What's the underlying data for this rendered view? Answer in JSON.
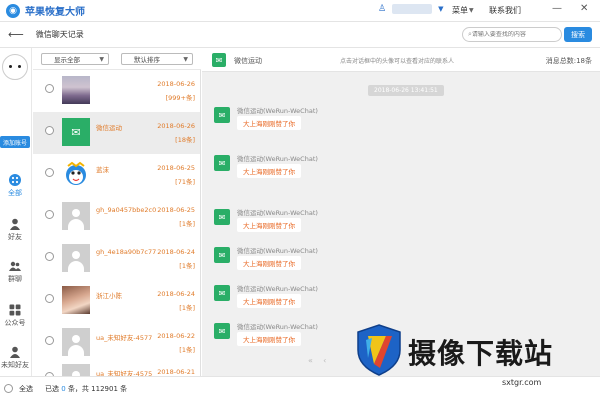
{
  "app": {
    "title": "苹果恢复大师",
    "menu_label": "菜单",
    "contact_label": "联系我们",
    "user_icon": "user-icon"
  },
  "subbar": {
    "title": "微信聊天记录",
    "search_placeholder": "请输入要查找的内容",
    "search_button": "搜索"
  },
  "leftnav": {
    "add_account": "添加账号",
    "items": [
      {
        "label": "全部",
        "icon": "grid-dots-icon",
        "active": true
      },
      {
        "label": "好友",
        "icon": "person-icon",
        "active": false
      },
      {
        "label": "群聊",
        "icon": "group-icon",
        "active": false
      },
      {
        "label": "公众号",
        "icon": "apps-icon",
        "active": false
      },
      {
        "label": "未知好友",
        "icon": "unknown-person-icon",
        "active": false
      }
    ]
  },
  "filters": {
    "show": "显示全部",
    "sort": "默认排序"
  },
  "contacts": [
    {
      "name": "",
      "date": "2018-06-26",
      "count": "[999+条]",
      "thumb": "landscape"
    },
    {
      "name": "微信运动",
      "date": "2018-06-26",
      "count": "[18条]",
      "thumb": "wechat",
      "selected": true
    },
    {
      "name": "蓝沫",
      "date": "2018-06-25",
      "count": "[71条]",
      "thumb": "cartoon"
    },
    {
      "name": "gh_9a0457bbe2c0",
      "date": "2018-06-25",
      "count": "[1条]",
      "thumb": "gray"
    },
    {
      "name": "gh_4e18a90b7c77",
      "date": "2018-06-24",
      "count": "[1条]",
      "thumb": "gray"
    },
    {
      "name": "浙江小陈",
      "date": "2018-06-24",
      "count": "[1条]",
      "thumb": "photo"
    },
    {
      "name": "ua_未知好友-4577",
      "date": "2018-06-22",
      "count": "[1条]",
      "thumb": "gray"
    },
    {
      "name": "ua_未知好友-4575",
      "date": "2018-06-21",
      "count": "",
      "thumb": "gray"
    }
  ],
  "chat": {
    "name": "微信运动",
    "hint": "点击对话框中的头像可以查看对应的联系人",
    "total": "消息总数:18条",
    "timestamp": "2018-06-26 13:41:51",
    "messages": [
      {
        "sender": "微信运动(WeRun-WeChat)",
        "text": "大上海刚刚赞了你"
      },
      {
        "sender": "微信运动(WeRun-WeChat)",
        "text": "大上海刚刚赞了你"
      },
      {
        "sender": "微信运动(WeRun-WeChat)",
        "text": "大上海刚刚赞了你"
      },
      {
        "sender": "微信运动(WeRun-WeChat)",
        "text": "大上海刚刚赞了你"
      },
      {
        "sender": "微信运动(WeRun-WeChat)",
        "text": "大上海刚刚赞了你"
      },
      {
        "sender": "微信运动(WeRun-WeChat)",
        "text": "大上海刚刚赞了你"
      }
    ]
  },
  "footer": {
    "select_all": "全选",
    "selected_prefix": "已选",
    "selected_count": "0",
    "selected_suffix": "条，共",
    "total_count": "112901",
    "total_suffix": "条"
  },
  "watermark": {
    "text": "摄像下载站",
    "url": "sxtgr.com"
  },
  "colors": {
    "accent": "#2a8be0",
    "wechat_green": "#2aae67",
    "orange_text": "#e07b2a",
    "bubble_text": "#e8651f"
  }
}
